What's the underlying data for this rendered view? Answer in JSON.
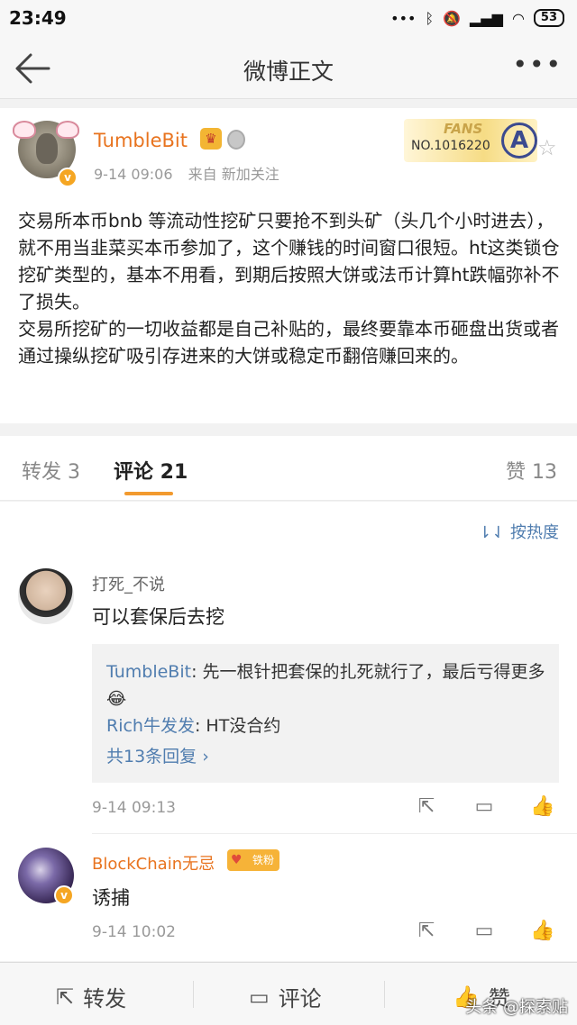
{
  "status_bar": {
    "time": "23:49",
    "icons": [
      "dots-icon",
      "bluetooth-icon",
      "mute-icon",
      "signal-icon",
      "wifi-icon"
    ],
    "battery": "53"
  },
  "nav": {
    "title": "微博正文"
  },
  "post": {
    "author": "TumbleBit",
    "time": "9-14 09:06",
    "source": "来自 新加关注",
    "fans_word": "FANS",
    "fans_no": "NO.1016220",
    "text": "交易所本币bnb 等流动性挖矿只要抢不到头矿（头几个小时进去），就不用当韭菜买本币参加了，这个赚钱的时间窗口很短。ht这类锁仓挖矿类型的，基本不用看，到期后按照大饼或法币计算ht跌幅弥补不了损失。\n交易所挖矿的一切收益都是自己补贴的，最终要靠本币砸盘出货或者通过操纵挖矿吸引存进来的大饼或稳定币翻倍赚回来的。"
  },
  "tabs": {
    "repost": "转发 3",
    "comment": "评论 21",
    "like": "赞 13"
  },
  "sort_label": "按热度",
  "comments": [
    {
      "name": "打死_不说",
      "text": "可以套保后去挖",
      "replies": [
        {
          "user": "TumbleBit",
          "text": ": 先一根针把套保的扎死就行了，最后亏得更多😂"
        },
        {
          "user": "Rich牛发发",
          "text": ": HT没合约"
        }
      ],
      "more_replies": "共13条回复 ›",
      "time": "9-14 09:13"
    },
    {
      "name": "BlockChain无忌",
      "badge": "铁粉",
      "text": "诱捕",
      "time": "9-14 10:02"
    }
  ],
  "bottom_bar": {
    "repost": "转发",
    "comment": "评论",
    "like": "赞",
    "watermark": "头条 @探索贴"
  }
}
